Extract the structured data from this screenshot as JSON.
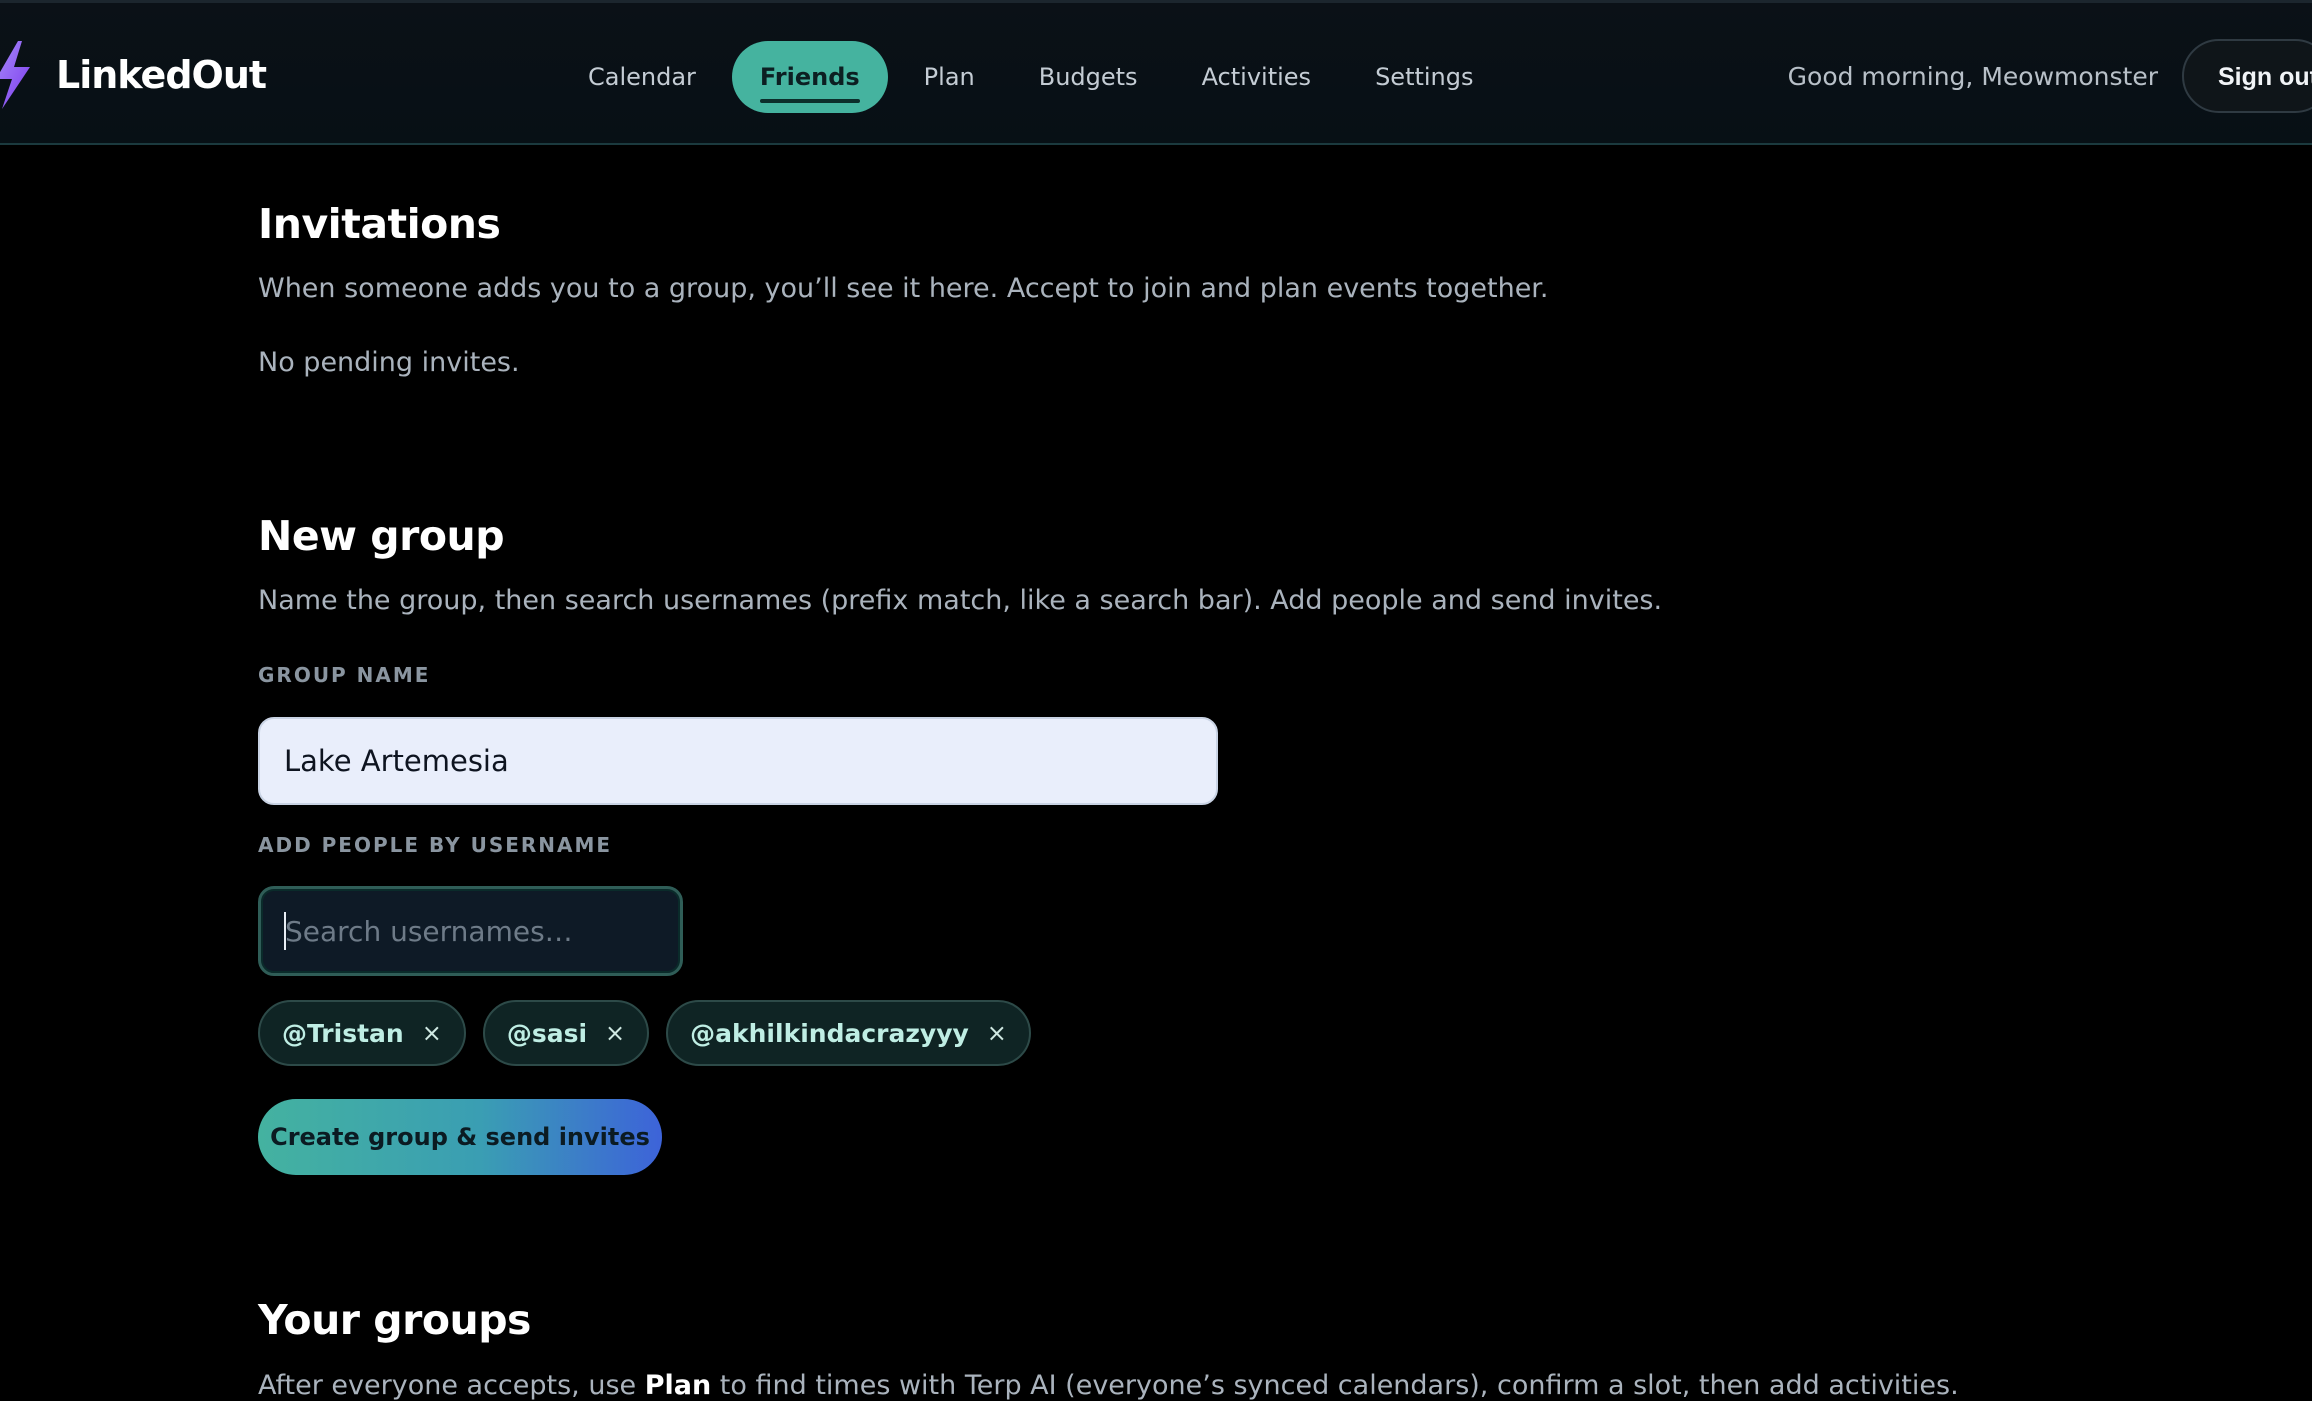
{
  "app": {
    "name": "LinkedOut",
    "logo_icon": "lightning-bolt-icon",
    "accent_color": "#45b39f",
    "logo_color": "#8b5cf6"
  },
  "nav": {
    "items": [
      {
        "label": "Calendar",
        "active": false
      },
      {
        "label": "Friends",
        "active": true
      },
      {
        "label": "Plan",
        "active": false
      },
      {
        "label": "Budgets",
        "active": false
      },
      {
        "label": "Activities",
        "active": false
      },
      {
        "label": "Settings",
        "active": false
      }
    ]
  },
  "header": {
    "greeting": "Good morning, Meowmonster",
    "sign_out_label": "Sign out"
  },
  "invitations": {
    "title": "Invitations",
    "description": "When someone adds you to a group, you’ll see it here. Accept to join and plan events together.",
    "empty_text": "No pending invites."
  },
  "new_group": {
    "title": "New group",
    "description": "Name the group, then search usernames (prefix match, like a search bar). Add people and send invites.",
    "group_name_label": "GROUP NAME",
    "group_name_value": "Lake Artemesia",
    "add_people_label": "ADD PEOPLE BY USERNAME",
    "search_placeholder": "Search usernames…",
    "search_value": "",
    "chips": [
      {
        "label": "@Tristan",
        "remove_icon": "close-icon"
      },
      {
        "label": "@sasi",
        "remove_icon": "close-icon"
      },
      {
        "label": "@akhilkindacrazyyy",
        "remove_icon": "close-icon"
      }
    ],
    "chip_remove_glyph": "×",
    "create_button_label": "Create group & send invites",
    "create_button_colors": [
      "#44b2a0",
      "#3d63d9"
    ]
  },
  "your_groups": {
    "title": "Your groups",
    "description_prefix": "After everyone accepts, use ",
    "description_link": "Plan",
    "description_suffix": " to find times with Terp AI (everyone’s synced calendars), confirm a slot, then add activities."
  }
}
